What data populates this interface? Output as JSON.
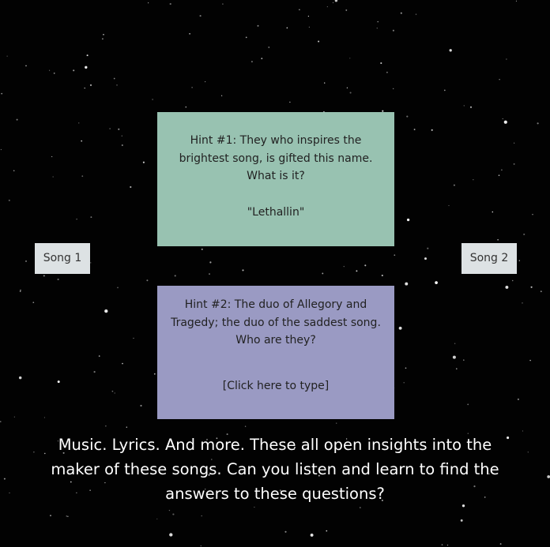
{
  "colors": {
    "background": "#020202",
    "hint1_card": "#98c2b1",
    "hint2_card": "#9a9ac3",
    "song_button": "#dde2e4",
    "star": "#ffffff"
  },
  "songs": {
    "song1_label": "Song 1",
    "song2_label": "Song 2"
  },
  "hints": {
    "hint1": {
      "question": "Hint #1: They who inspires the brightest song, is gifted this name. What is it?",
      "answer": "\"Lethallin\""
    },
    "hint2": {
      "question": "Hint #2: The duo of Allegory and Tragedy; the duo of the saddest song. Who are they?",
      "answer": "[Click here to type]"
    }
  },
  "intro_text": "Music. Lyrics. And more. These all open insights into the maker of these songs. Can you listen and learn to find the answers to these questions?"
}
